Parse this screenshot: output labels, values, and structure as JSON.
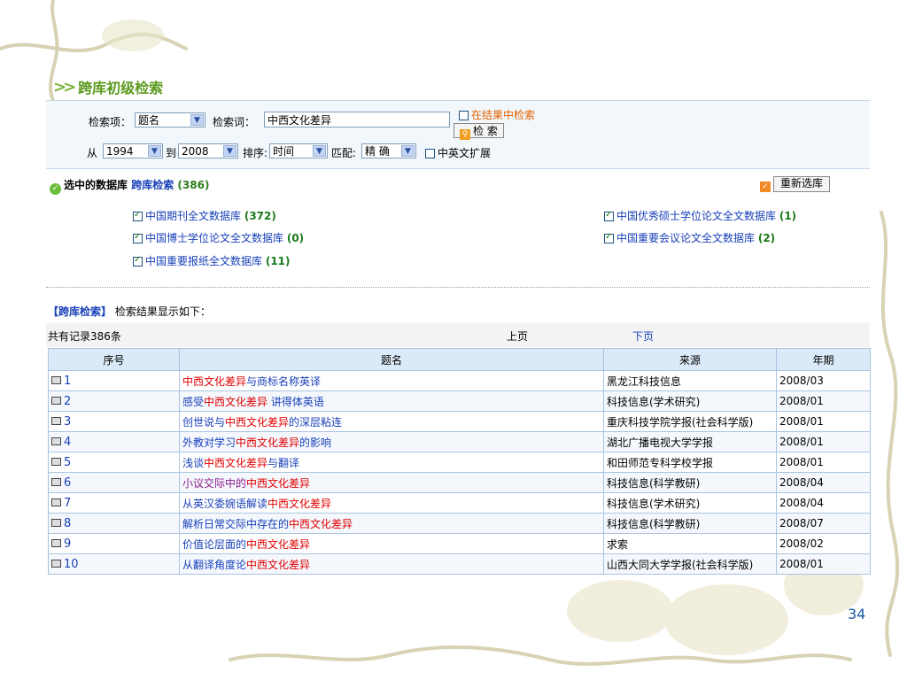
{
  "panel_title": "跨库初级检索",
  "search": {
    "field_label": "检索项：",
    "field_value": "题名",
    "term_label": "检索词：",
    "term_value": "中西文化差异",
    "in_results_label": "在结果中检索",
    "search_button": "检 索",
    "from_label": "从",
    "from_year": "1994",
    "to_label": "到",
    "to_year": "2008",
    "sort_label": "排序:",
    "sort_value": "时间",
    "match_label": "匹配:",
    "match_value": "精 确",
    "expand_label": "中英文扩展"
  },
  "databases": {
    "header_label": "选中的数据库",
    "cross_label": "跨库检索",
    "cross_count": "(386)",
    "reselect_button": "重新选库",
    "items": [
      {
        "name": "中国期刊全文数据库",
        "count": "(372)"
      },
      {
        "name": "中国优秀硕士学位论文全文数据库",
        "count": "(1)"
      },
      {
        "name": "中国博士学位论文全文数据库",
        "count": "(0)"
      },
      {
        "name": "中国重要会议论文全文数据库",
        "count": "(2)"
      },
      {
        "name": "中国重要报纸全文数据库",
        "count": "(11)"
      }
    ]
  },
  "results": {
    "tag": "【跨库检索】",
    "caption": "检索结果显示如下：",
    "total": "共有记录386条",
    "prev": "上页",
    "next": "下页",
    "columns": [
      "序号",
      "题名",
      "来源",
      "年期"
    ],
    "rows": [
      {
        "no": "1",
        "title": [
          [
            "中西文化差异",
            "red"
          ],
          [
            "与商标名称英译",
            "blue"
          ]
        ],
        "source": "黑龙江科技信息",
        "date": "2008/03"
      },
      {
        "no": "2",
        "title": [
          [
            "感受",
            "blue"
          ],
          [
            "中西文化差异",
            "red"
          ],
          [
            " 讲得体英语",
            "blue"
          ]
        ],
        "source": "科技信息(学术研究)",
        "date": "2008/01"
      },
      {
        "no": "3",
        "title": [
          [
            "创世说与",
            "blue"
          ],
          [
            "中西文化差异",
            "red"
          ],
          [
            "的深层粘连",
            "blue"
          ]
        ],
        "source": "重庆科技学院学报(社会科学版)",
        "date": "2008/01"
      },
      {
        "no": "4",
        "title": [
          [
            "外教对学习",
            "blue"
          ],
          [
            "中西文化差异",
            "red"
          ],
          [
            "的影响",
            "blue"
          ]
        ],
        "source": "湖北广播电视大学学报",
        "date": "2008/01"
      },
      {
        "no": "5",
        "title": [
          [
            "浅谈",
            "blue"
          ],
          [
            "中西文化差异",
            "red"
          ],
          [
            "与翻译",
            "blue"
          ]
        ],
        "source": "和田师范专科学校学报",
        "date": "2008/01"
      },
      {
        "no": "6",
        "title": [
          [
            "小议交际中的",
            "purple"
          ],
          [
            "中西文化差异",
            "red"
          ]
        ],
        "source": "科技信息(科学教研)",
        "date": "2008/04"
      },
      {
        "no": "7",
        "title": [
          [
            "从英汉委婉语解读",
            "blue"
          ],
          [
            "中西文化差异",
            "red"
          ]
        ],
        "source": "科技信息(学术研究)",
        "date": "2008/04"
      },
      {
        "no": "8",
        "title": [
          [
            "解析日常交际中存在的",
            "blue"
          ],
          [
            "中西文化差异",
            "red"
          ]
        ],
        "source": "科技信息(科学教研)",
        "date": "2008/07"
      },
      {
        "no": "9",
        "title": [
          [
            "价值论层面的",
            "blue"
          ],
          [
            "中西文化差异",
            "red"
          ]
        ],
        "source": "求索",
        "date": "2008/02"
      },
      {
        "no": "10",
        "title": [
          [
            "从翻译角度论",
            "blue"
          ],
          [
            "中西文化差异",
            "red"
          ]
        ],
        "source": "山西大同大学学报(社会科学版)",
        "date": "2008/01"
      }
    ]
  },
  "slide_number": "34",
  "colors": {
    "accent_green": "#5a9a1c",
    "link_blue": "#1840b8",
    "highlight_red": "#e00000",
    "header_bg": "#dbeaf8"
  }
}
